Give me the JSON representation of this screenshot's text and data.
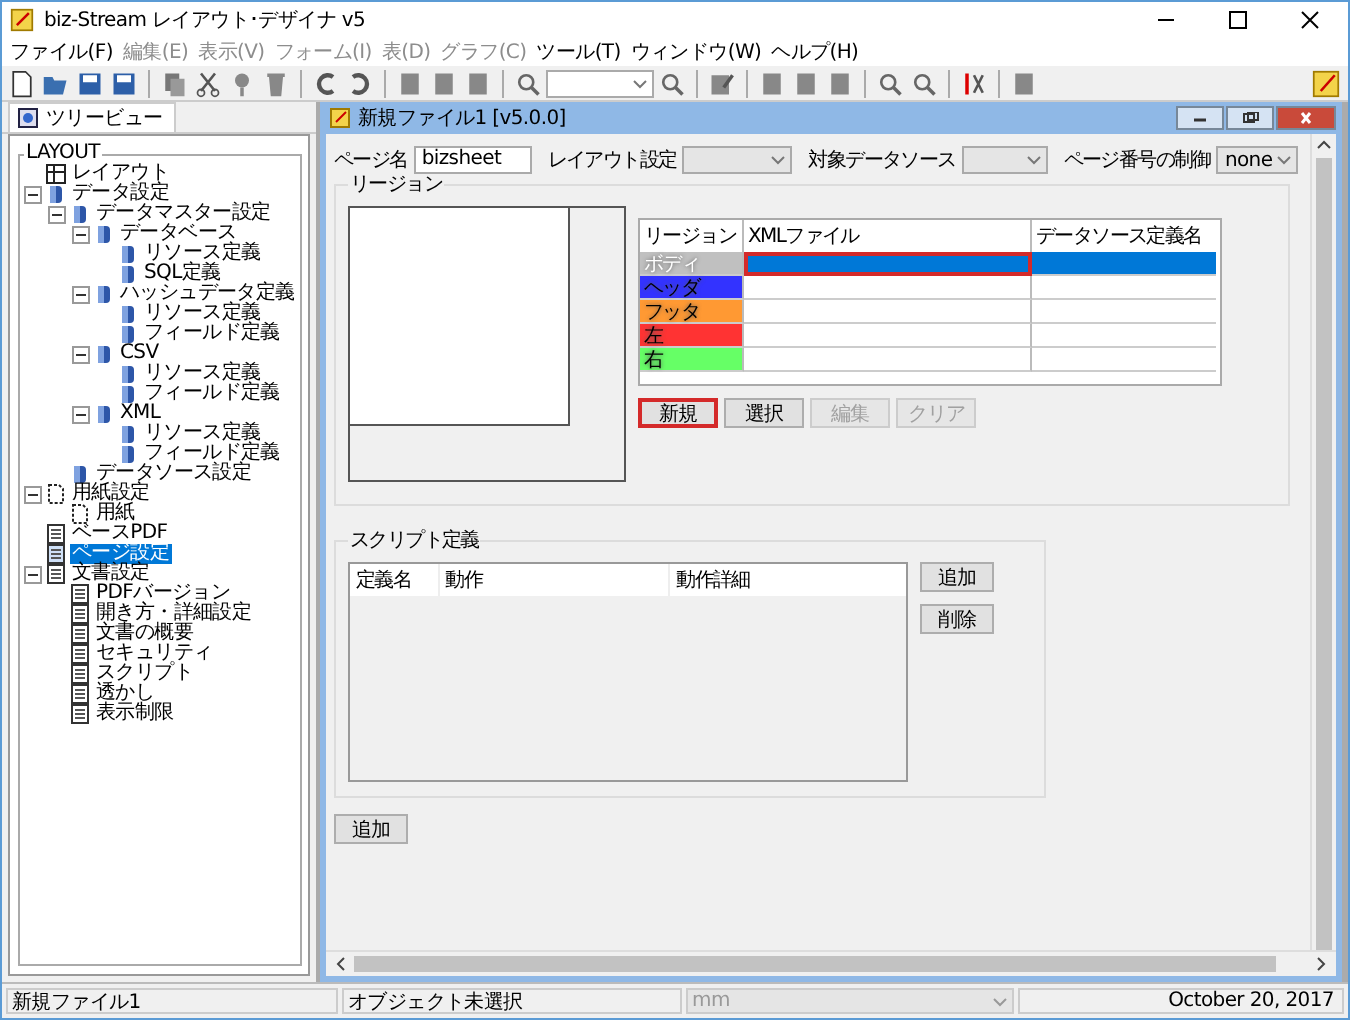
{
  "window": {
    "title": "biz-Stream レイアウト･デザイナ v5"
  },
  "menu": [
    {
      "label": "ファイル(F)",
      "disabled": false
    },
    {
      "label": "編集(E)",
      "disabled": true
    },
    {
      "label": "表示(V)",
      "disabled": true
    },
    {
      "label": "フォーム(I)",
      "disabled": true
    },
    {
      "label": "表(D)",
      "disabled": true
    },
    {
      "label": "グラフ(C)",
      "disabled": true
    },
    {
      "label": "ツール(T)",
      "disabled": false
    },
    {
      "label": "ウィンドウ(W)",
      "disabled": false
    },
    {
      "label": "ヘルプ(H)",
      "disabled": false
    }
  ],
  "tree_tab": {
    "label": "ツリービュー"
  },
  "tree": {
    "title": "LAYOUT",
    "items": [
      {
        "label": "レイアウト",
        "kind": "layout",
        "selected": false
      },
      {
        "label": "データ設定",
        "kind": "db",
        "selected": false,
        "expanded": true,
        "children": [
          {
            "label": "データマスター設定",
            "kind": "db",
            "selected": false,
            "expanded": true,
            "children": [
              {
                "label": "データベース",
                "kind": "db",
                "selected": false,
                "expanded": true,
                "children": [
                  {
                    "label": "リソース定義",
                    "kind": "db",
                    "selected": false
                  },
                  {
                    "label": "SQL定義",
                    "kind": "db",
                    "selected": false
                  }
                ]
              },
              {
                "label": "ハッシュデータ定義",
                "kind": "db",
                "selected": false,
                "expanded": true,
                "children": [
                  {
                    "label": "リソース定義",
                    "kind": "db",
                    "selected": false
                  },
                  {
                    "label": "フィールド定義",
                    "kind": "db",
                    "selected": false
                  }
                ]
              },
              {
                "label": "CSV",
                "kind": "db",
                "selected": false,
                "expanded": true,
                "children": [
                  {
                    "label": "リソース定義",
                    "kind": "db",
                    "selected": false
                  },
                  {
                    "label": "フィールド定義",
                    "kind": "db",
                    "selected": false
                  }
                ]
              },
              {
                "label": "XML",
                "kind": "db",
                "selected": false,
                "expanded": true,
                "children": [
                  {
                    "label": "リソース定義",
                    "kind": "db",
                    "selected": false
                  },
                  {
                    "label": "フィールド定義",
                    "kind": "db",
                    "selected": false
                  }
                ]
              }
            ]
          },
          {
            "label": "データソース設定",
            "kind": "db",
            "selected": false
          }
        ]
      },
      {
        "label": "用紙設定",
        "kind": "paper",
        "selected": false,
        "expanded": true,
        "children": [
          {
            "label": "用紙",
            "kind": "paper",
            "selected": false
          }
        ]
      },
      {
        "label": "ベースPDF",
        "kind": "doc",
        "selected": false
      },
      {
        "label": "ページ設定",
        "kind": "doc",
        "selected": true
      },
      {
        "label": "文書設定",
        "kind": "doc",
        "selected": false,
        "expanded": true,
        "children": [
          {
            "label": "PDFバージョン",
            "kind": "doc",
            "selected": false
          },
          {
            "label": "開き方・詳細設定",
            "kind": "doc",
            "selected": false
          },
          {
            "label": "文書の概要",
            "kind": "doc",
            "selected": false
          },
          {
            "label": "セキュリティ",
            "kind": "doc",
            "selected": false
          },
          {
            "label": "スクリプト",
            "kind": "doc",
            "selected": false
          },
          {
            "label": "透かし",
            "kind": "doc",
            "selected": false
          },
          {
            "label": "表示制限",
            "kind": "doc",
            "selected": false
          }
        ]
      }
    ]
  },
  "document": {
    "title": "新規ファイル1 [v5.0.0]",
    "page_name": {
      "label": "ページ名",
      "value": "bizsheet"
    },
    "layout_setting": {
      "label": "レイアウト設定"
    },
    "target_datasource": {
      "label": "対象データソース"
    },
    "page_number_control": {
      "label": "ページ番号の制御",
      "value": "none"
    },
    "region": {
      "title": "リージョン",
      "columns": [
        "リージョン",
        "XMLファイル",
        "データソース定義名"
      ],
      "rows": [
        {
          "name": "ボディ",
          "color": "#c0c0c0",
          "selected": true,
          "focused": true
        },
        {
          "name": "ヘッダ",
          "color": "#3333ff",
          "selected": false,
          "focused": false
        },
        {
          "name": "フッタ",
          "color": "#ff9933",
          "selected": false,
          "focused": false
        },
        {
          "name": "左",
          "color": "#ff3333",
          "selected": false,
          "focused": false
        },
        {
          "name": "右",
          "color": "#66ff66",
          "selected": false,
          "focused": false
        }
      ],
      "buttons": [
        {
          "label": "新規",
          "disabled": false,
          "focused": true
        },
        {
          "label": "選択",
          "disabled": false,
          "focused": false
        },
        {
          "label": "編集",
          "disabled": true,
          "focused": false
        },
        {
          "label": "クリア",
          "disabled": true,
          "focused": false
        }
      ]
    },
    "script": {
      "title": "スクリプト定義",
      "columns": [
        "定義名",
        "動作",
        "動作詳細"
      ],
      "buttons": [
        {
          "label": "追加"
        },
        {
          "label": "削除"
        }
      ]
    },
    "add_button": {
      "label": "追加"
    }
  },
  "status_bar": {
    "file": "新規ファイル1",
    "selection": "オブジェクト未選択",
    "unit": "mm",
    "date": "October 20, 2017"
  }
}
